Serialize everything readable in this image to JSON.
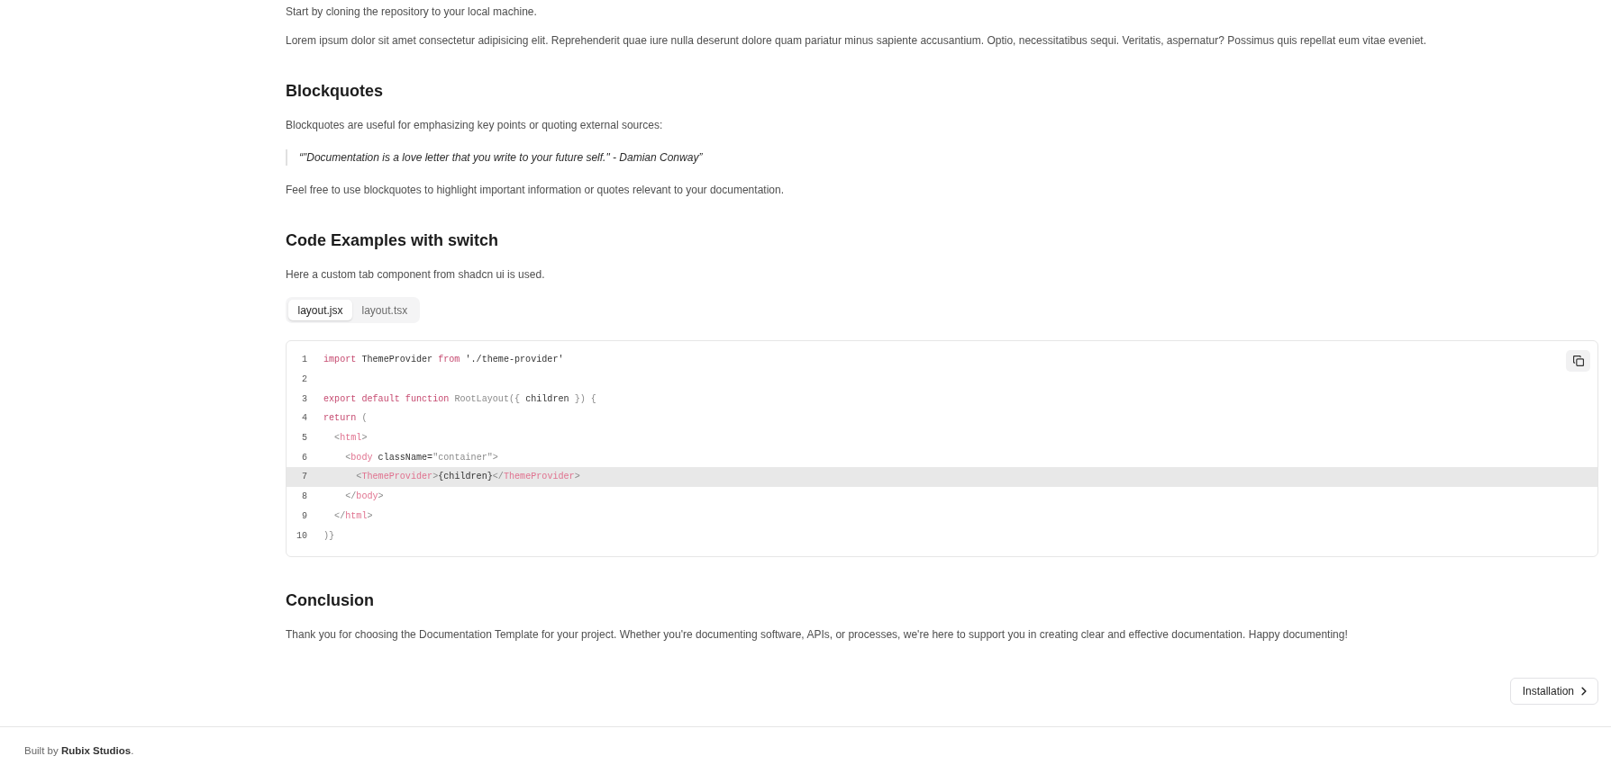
{
  "content": [
    {
      "kind": "paragraph",
      "text": "Start by cloning the repository to your local machine."
    },
    {
      "kind": "paragraph",
      "text": "Lorem ipsum dolor sit amet consectetur adipisicing elit. Reprehenderit quae iure nulla deserunt dolore quam pariatur minus sapiente accusantium. Optio, necessitatibus sequi. Veritatis, aspernatur? Possimus quis repellat eum vitae eveniet."
    },
    {
      "kind": "heading",
      "text": "Blockquotes"
    },
    {
      "kind": "paragraph",
      "text": "Blockquotes are useful for emphasizing key points or quoting external sources:"
    },
    {
      "kind": "blockquote",
      "text": "“\"Documentation is a love letter that you write to your future self.\" - Damian Conway”"
    },
    {
      "kind": "paragraph",
      "text": "Feel free to use blockquotes to highlight important information or quotes relevant to your documentation."
    },
    {
      "kind": "heading",
      "text": "Code Examples with switch"
    },
    {
      "kind": "paragraph",
      "text": "Here a custom tab component from shadcn ui is used."
    },
    {
      "kind": "tabs",
      "tabs": [
        {
          "label": "layout.jsx",
          "selected": true
        },
        {
          "label": "layout.tsx",
          "selected": false
        }
      ]
    },
    {
      "kind": "code",
      "lines": [
        {
          "number": "1",
          "highlighted": false,
          "tokens": [
            {
              "kind": "keyword",
              "text": "import"
            },
            {
              "kind": "plain",
              "text": " ThemeProvider "
            },
            {
              "kind": "keyword",
              "text": "from"
            },
            {
              "kind": "plain",
              "text": " './theme-provider'"
            }
          ]
        },
        {
          "number": "2",
          "highlighted": false
        },
        {
          "number": "3",
          "highlighted": false,
          "tokens": [
            {
              "kind": "keyword",
              "text": "export default function"
            },
            {
              "kind": "muted",
              "text": " RootLayout({ "
            },
            {
              "kind": "plain",
              "text": "children"
            },
            {
              "kind": "muted",
              "text": " }) {"
            }
          ]
        },
        {
          "number": "4",
          "highlighted": false,
          "tokens": [
            {
              "kind": "keyword",
              "text": "return"
            },
            {
              "kind": "muted",
              "text": " ("
            }
          ]
        },
        {
          "number": "5",
          "highlighted": false,
          "tokens": [
            {
              "kind": "muted",
              "text": "  <"
            },
            {
              "kind": "tag",
              "text": "html"
            },
            {
              "kind": "muted",
              "text": ">"
            }
          ]
        },
        {
          "number": "6",
          "highlighted": false,
          "tokens": [
            {
              "kind": "muted",
              "text": "    <"
            },
            {
              "kind": "tag",
              "text": "body"
            },
            {
              "kind": "plain",
              "text": " className="
            },
            {
              "kind": "muted",
              "text": "\"container\">"
            }
          ]
        },
        {
          "number": "7",
          "highlighted": true,
          "tokens": [
            {
              "kind": "muted",
              "text": "      <"
            },
            {
              "kind": "tag",
              "text": "ThemeProvider"
            },
            {
              "kind": "muted",
              "text": ">"
            },
            {
              "kind": "plain",
              "text": "{children}"
            },
            {
              "kind": "muted",
              "text": "</"
            },
            {
              "kind": "tag",
              "text": "ThemeProvider"
            },
            {
              "kind": "muted",
              "text": ">"
            }
          ]
        },
        {
          "number": "8",
          "highlighted": false,
          "tokens": [
            {
              "kind": "muted",
              "text": "    </"
            },
            {
              "kind": "tag",
              "text": "body"
            },
            {
              "kind": "muted",
              "text": ">"
            }
          ]
        },
        {
          "number": "9",
          "highlighted": false,
          "tokens": [
            {
              "kind": "muted",
              "text": "  </"
            },
            {
              "kind": "tag",
              "text": "html"
            },
            {
              "kind": "muted",
              "text": ">"
            }
          ]
        },
        {
          "number": "10",
          "highlighted": false,
          "tokens": [
            {
              "kind": "muted",
              "text": ")}"
            }
          ]
        }
      ]
    },
    {
      "kind": "heading",
      "text": "Conclusion"
    },
    {
      "kind": "paragraph",
      "text": "Thank you for choosing the Documentation Template for your project. Whether you're documenting software, APIs, or processes, we're here to support you in creating clear and effective documentation. Happy documenting!"
    }
  ],
  "next_button": {
    "label": "Installation"
  },
  "footer": {
    "text": "Built by **Rubix Studios**."
  }
}
